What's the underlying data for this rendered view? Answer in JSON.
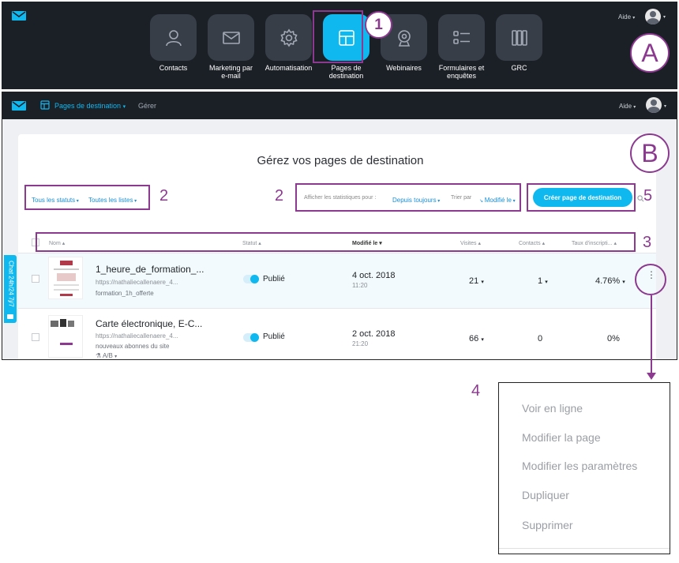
{
  "launcher": {
    "apps": [
      {
        "label": "Contacts",
        "icon": "contact-icon",
        "active": false
      },
      {
        "label": "Marketing par\ne-mail",
        "icon": "envelope-icon",
        "active": false
      },
      {
        "label": "Automatisation",
        "icon": "gear-icon",
        "active": false
      },
      {
        "label": "Pages de\ndestination",
        "icon": "layout-icon",
        "active": true
      },
      {
        "label": "Webinaires",
        "icon": "webcam-icon",
        "active": false
      },
      {
        "label": "Formulaires et\nenquêtes",
        "icon": "list-icon",
        "active": false
      },
      {
        "label": "GRC",
        "icon": "columns-icon",
        "active": false
      }
    ],
    "help_label": "Aide"
  },
  "annotations": {
    "callout_1": "1",
    "panel_a": "A",
    "panel_b": "B",
    "label_2_left": "2",
    "label_2_right": "2",
    "label_3": "3",
    "label_4": "4",
    "label_5": "5"
  },
  "app_header": {
    "section_label": "Pages de destination",
    "sub_label": "Gérer",
    "help_label": "Aide"
  },
  "main": {
    "title": "Gérez vos pages de destination",
    "filters": {
      "status": "Tous les statuts",
      "lists": "Toutes les listes",
      "stats_label": "Afficher les statistiques pour :",
      "stats_value": "Depuis toujours",
      "sort_label": "Trier par",
      "sort_value": "Modifié le"
    },
    "create_button": "Créer page de destination",
    "columns": {
      "name": "Nom",
      "status": "Statut",
      "modified": "Modifié le",
      "visits": "Visites",
      "contacts": "Contacts",
      "rate": "Taux d'inscripti..."
    },
    "rows": [
      {
        "name": "1_heure_de_formation_...",
        "url": "https://nathaliecallenaere_4...",
        "sub": "formation_1h_offerte",
        "status": "Publié",
        "date": "4 oct. 2018",
        "time": "11:20",
        "visits": "21",
        "contacts": "1",
        "rate": "4.76%"
      },
      {
        "name": "Carte électronique, E-C...",
        "url": "https://nathaliecallenaere_4...",
        "sub": "nouveaux abonnes du site",
        "ab": "A/B",
        "status": "Publié",
        "date": "2 oct. 2018",
        "time": "21:20",
        "visits": "66",
        "contacts": "0",
        "rate": "0%"
      }
    ],
    "chat_tab": "Chat 24h/24 7j/7"
  },
  "dropdown": {
    "items": [
      "Voir en ligne",
      "Modifier la page",
      "Modifier les paramètres",
      "Dupliquer",
      "Supprimer"
    ]
  },
  "colors": {
    "accent": "#10b8f0",
    "dark_bar": "#1b1f26",
    "annotation": "#8b3a8f"
  }
}
